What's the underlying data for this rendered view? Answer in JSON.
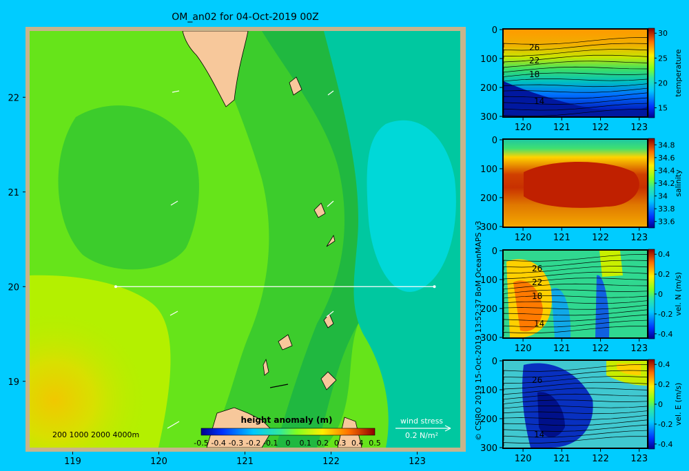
{
  "title": "OM_an02 for 04-Oct-2019 00Z",
  "credit": "© CSIRO 2019  15-Oct-2019 13:52:37 BoM OceanMAPS v3",
  "colors": {
    "background": "#00ccff",
    "land": "#f7c89b",
    "frame": "#c8b48c"
  },
  "chart_data": [
    {
      "type": "heatmap",
      "name": "map",
      "x_ticks": [
        "119",
        "120",
        "121",
        "122",
        "123"
      ],
      "x_tick_values": [
        119,
        120,
        121,
        122,
        123
      ],
      "y_ticks": [
        "22",
        "21",
        "20",
        "19"
      ],
      "y_tick_values": [
        22,
        21,
        20,
        19
      ],
      "xlim": [
        118.5,
        123.5
      ],
      "ylim": [
        18.3,
        22.7
      ],
      "section_line": {
        "lon": [
          119.5,
          123.2
        ],
        "lat": [
          20,
          20
        ]
      },
      "depth_legend": "200  1000  2000  4000m",
      "colorbar": {
        "label": "height anomaly (m)",
        "ticks": [
          "-0.5",
          "-0.4",
          "-0.3",
          "-0.2",
          "-0.1",
          "0",
          "0.1",
          "0.2",
          "0.3",
          "0.4",
          "0.5"
        ],
        "range": [
          -0.5,
          0.5
        ]
      },
      "wind_stress": {
        "label": "wind stress",
        "scale": "0.2 N/m²"
      }
    },
    {
      "type": "heatmap",
      "name": "temperature section",
      "xlabel_ticks": [
        "120",
        "121",
        "122",
        "123"
      ],
      "ylabel_ticks": [
        "0",
        "100",
        "200",
        "300"
      ],
      "xlim": [
        119.5,
        123.2
      ],
      "ylim": [
        300,
        0
      ],
      "contour_labels": [
        "26",
        "22",
        "18",
        "14"
      ],
      "colorbar": {
        "label": "temperature",
        "ticks": [
          "30",
          "25",
          "20",
          "15"
        ],
        "range": [
          13,
          31
        ]
      }
    },
    {
      "type": "heatmap",
      "name": "salinity section",
      "xlabel_ticks": [
        "120",
        "121",
        "122",
        "123"
      ],
      "ylabel_ticks": [
        "0",
        "100",
        "200",
        "300"
      ],
      "xlim": [
        119.5,
        123.2
      ],
      "ylim": [
        300,
        0
      ],
      "colorbar": {
        "label": "salinity",
        "ticks": [
          "34.8",
          "34.6",
          "34.4",
          "34.2",
          "34",
          "33.8",
          "33.6"
        ],
        "range": [
          33.5,
          34.9
        ]
      }
    },
    {
      "type": "heatmap",
      "name": "northward velocity section",
      "xlabel_ticks": [
        "120",
        "121",
        "122",
        "123"
      ],
      "ylabel_ticks": [
        "0",
        "100",
        "200",
        "300"
      ],
      "xlim": [
        119.5,
        123.2
      ],
      "ylim": [
        300,
        0
      ],
      "contour_labels": [
        "26",
        "22",
        "18",
        "14"
      ],
      "colorbar": {
        "label": "vel. N  (m/s)",
        "ticks": [
          "0.4",
          "0.2",
          "0",
          "-0.2",
          "-0.4"
        ],
        "range": [
          -0.45,
          0.45
        ]
      }
    },
    {
      "type": "heatmap",
      "name": "eastward velocity section",
      "xlabel_ticks": [
        "120",
        "121",
        "122",
        "123"
      ],
      "ylabel_ticks": [
        "0",
        "100",
        "200",
        "300"
      ],
      "xlim": [
        119.5,
        123.2
      ],
      "ylim": [
        300,
        0
      ],
      "contour_labels": [
        "26",
        "14"
      ],
      "colorbar": {
        "label": "vel. E  (m/s)",
        "ticks": [
          "0.4",
          "0.2",
          "0",
          "-0.2",
          "-0.4"
        ],
        "range": [
          -0.45,
          0.45
        ]
      }
    }
  ]
}
